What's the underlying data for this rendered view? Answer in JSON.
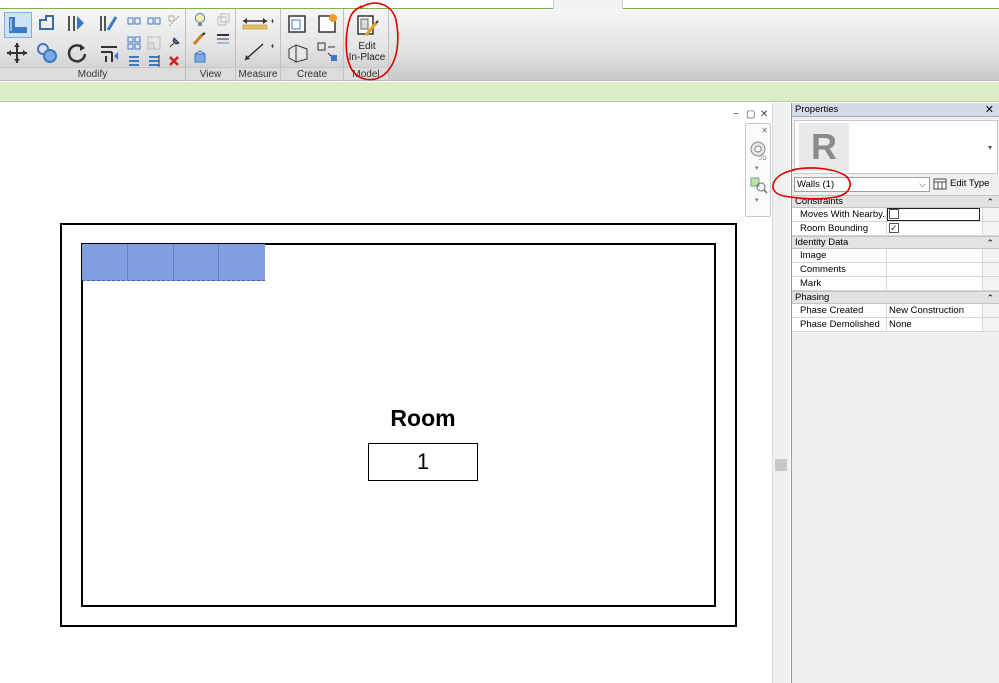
{
  "ribbon": {
    "panels": {
      "modify": "Modify",
      "view": "View",
      "measure": "Measure",
      "create": "Create",
      "model": "Model"
    },
    "edit_in_place": {
      "line1": "Edit",
      "line2": "In-Place"
    }
  },
  "canvas": {
    "room_name": "Room",
    "room_number": "1",
    "window_controls": [
      "−",
      "▢",
      "✕"
    ]
  },
  "properties": {
    "title": "Properties",
    "close": "✕",
    "logo_letter": "R",
    "type_selector": "Walls (1)",
    "edit_type": "Edit Type",
    "groups": [
      {
        "name": "Constraints",
        "rows": [
          {
            "key": "Moves With Nearby...",
            "value": "",
            "checkbox": false
          },
          {
            "key": "Room Bounding",
            "value": "",
            "checkbox": true
          }
        ]
      },
      {
        "name": "Identity Data",
        "rows": [
          {
            "key": "Image",
            "value": ""
          },
          {
            "key": "Comments",
            "value": ""
          },
          {
            "key": "Mark",
            "value": ""
          }
        ]
      },
      {
        "name": "Phasing",
        "rows": [
          {
            "key": "Phase Created",
            "value": "New Construction"
          },
          {
            "key": "Phase Demolished",
            "value": "None"
          }
        ]
      }
    ]
  },
  "colors": {
    "ribbon_accent": "#7cb548",
    "selection_fill": "#7f9fde",
    "annotation_red": "#e00000",
    "options_bar": "#dcebc8"
  }
}
